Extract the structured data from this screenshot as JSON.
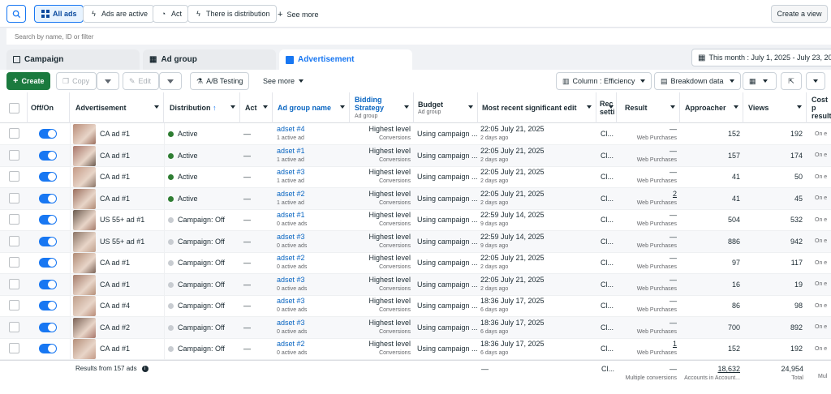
{
  "filters": {
    "all_ads": "All ads",
    "ads_active": "Ads are active",
    "act": "Act",
    "there_is_distribution": "There is distribution",
    "see_more": "See more",
    "create_view": "Create a view"
  },
  "search": {
    "placeholder": "Search by name, ID or filter"
  },
  "tabs": {
    "campaign": "Campaign",
    "ad_group": "Ad group",
    "advertisement": "Advertisement"
  },
  "date_range": "This month : July 1, 2025 - July 23, 2025",
  "toolbar": {
    "create": "Create",
    "copy": "Copy",
    "edit": "Edit",
    "ab_testing": "A/B Testing",
    "see_more": "See more",
    "column": "Column : Efficiency",
    "breakdown": "Breakdown data"
  },
  "columns": {
    "off_on": "Off/On",
    "advertisement": "Advertisement",
    "distribution": "Distribution",
    "act": "Act",
    "ad_group_name": "Ad group name",
    "bidding_strategy": "Bidding Strategy",
    "bidding_sub": "Ad group",
    "budget": "Budget",
    "budget_sub": "Ad group",
    "recent_edit": "Most recent significant edit",
    "rec_1": "Rec",
    "rec_2": "setti",
    "result": "Result",
    "approacher": "Approacher",
    "views": "Views",
    "cost_1": "Cost p",
    "cost_2": "result"
  },
  "rows": [
    {
      "ad": "CA ad #1",
      "dist": "Active",
      "act": "—",
      "adset": "adset #4",
      "adset_sub": "1 active ad",
      "bid": "Highest level",
      "bid_sub": "Conversions",
      "budget": "Using campaign ...",
      "edit": "22:05 July 21, 2025",
      "edit_sub": "2 days ago",
      "rec": "Cl...",
      "result": "—",
      "result_sub": "Web Purchases",
      "approacher": "152",
      "views": "192",
      "cost": "",
      "cost_sub": "On e"
    },
    {
      "ad": "CA ad #1",
      "dist": "Active",
      "act": "—",
      "adset": "adset #1",
      "adset_sub": "1 active ad",
      "bid": "Highest level",
      "bid_sub": "Conversions",
      "budget": "Using campaign ...",
      "edit": "22:05 July 21, 2025",
      "edit_sub": "2 days ago",
      "rec": "Cl...",
      "result": "—",
      "result_sub": "Web Purchases",
      "approacher": "157",
      "views": "174",
      "cost": "",
      "cost_sub": "On e"
    },
    {
      "ad": "CA ad #1",
      "dist": "Active",
      "act": "—",
      "adset": "adset #3",
      "adset_sub": "1 active ad",
      "bid": "Highest level",
      "bid_sub": "Conversions",
      "budget": "Using campaign ...",
      "edit": "22:05 July 21, 2025",
      "edit_sub": "2 days ago",
      "rec": "Cl...",
      "result": "—",
      "result_sub": "Web Purchases",
      "approacher": "41",
      "views": "50",
      "cost": "",
      "cost_sub": "On e"
    },
    {
      "ad": "CA ad #1",
      "dist": "Active",
      "act": "—",
      "adset": "adset #2",
      "adset_sub": "1 active ad",
      "bid": "Highest level",
      "bid_sub": "Conversions",
      "budget": "Using campaign ...",
      "edit": "22:05 July 21, 2025",
      "edit_sub": "2 days ago",
      "rec": "Cl...",
      "result": "2",
      "result_sub": "Web Purchases",
      "approacher": "41",
      "views": "45",
      "cost": "",
      "cost_sub": "On e"
    },
    {
      "ad": "US 55+ ad #1",
      "dist": "Campaign: Off",
      "act": "—",
      "adset": "adset #1",
      "adset_sub": "0 active ads",
      "bid": "Highest level",
      "bid_sub": "Conversions",
      "budget": "Using campaign ...",
      "edit": "22:59 July 14, 2025",
      "edit_sub": "9 days ago",
      "rec": "Cl...",
      "result": "—",
      "result_sub": "Web Purchases",
      "approacher": "504",
      "views": "532",
      "cost": "",
      "cost_sub": "On e"
    },
    {
      "ad": "US 55+ ad #1",
      "dist": "Campaign: Off",
      "act": "—",
      "adset": "adset #3",
      "adset_sub": "0 active ads",
      "bid": "Highest level",
      "bid_sub": "Conversions",
      "budget": "Using campaign ...",
      "edit": "22:59 July 14, 2025",
      "edit_sub": "9 days ago",
      "rec": "Cl...",
      "result": "—",
      "result_sub": "Web Purchases",
      "approacher": "886",
      "views": "942",
      "cost": "",
      "cost_sub": "On e"
    },
    {
      "ad": "CA ad #1",
      "dist": "Campaign: Off",
      "act": "—",
      "adset": "adset #2",
      "adset_sub": "0 active ads",
      "bid": "Highest level",
      "bid_sub": "Conversions",
      "budget": "Using campaign ...",
      "edit": "22:05 July 21, 2025",
      "edit_sub": "2 days ago",
      "rec": "Cl...",
      "result": "—",
      "result_sub": "Web Purchases",
      "approacher": "97",
      "views": "117",
      "cost": "",
      "cost_sub": "On e"
    },
    {
      "ad": "CA ad #1",
      "dist": "Campaign: Off",
      "act": "—",
      "adset": "adset #3",
      "adset_sub": "0 active ads",
      "bid": "Highest level",
      "bid_sub": "Conversions",
      "budget": "Using campaign ...",
      "edit": "22:05 July 21, 2025",
      "edit_sub": "2 days ago",
      "rec": "Cl...",
      "result": "—",
      "result_sub": "Web Purchases",
      "approacher": "16",
      "views": "19",
      "cost": "",
      "cost_sub": "On e"
    },
    {
      "ad": "CA ad #4",
      "dist": "Campaign: Off",
      "act": "—",
      "adset": "adset #3",
      "adset_sub": "0 active ads",
      "bid": "Highest level",
      "bid_sub": "Conversions",
      "budget": "Using campaign ...",
      "edit": "18:36 July 17, 2025",
      "edit_sub": "6 days ago",
      "rec": "Cl...",
      "result": "—",
      "result_sub": "Web Purchases",
      "approacher": "86",
      "views": "98",
      "cost": "",
      "cost_sub": "On e"
    },
    {
      "ad": "CA ad #2",
      "dist": "Campaign: Off",
      "act": "—",
      "adset": "adset #3",
      "adset_sub": "0 active ads",
      "bid": "Highest level",
      "bid_sub": "Conversions",
      "budget": "Using campaign ...",
      "edit": "18:36 July 17, 2025",
      "edit_sub": "6 days ago",
      "rec": "Cl...",
      "result": "—",
      "result_sub": "Web Purchases",
      "approacher": "700",
      "views": "892",
      "cost": "",
      "cost_sub": "On e"
    },
    {
      "ad": "CA ad #1",
      "dist": "Campaign: Off",
      "act": "—",
      "adset": "adset #2",
      "adset_sub": "0 active ads",
      "bid": "Highest level",
      "bid_sub": "Conversions",
      "budget": "Using campaign ...",
      "edit": "18:36 July 17, 2025",
      "edit_sub": "6 days ago",
      "rec": "Cl...",
      "result": "1",
      "result_sub": "Web Purchases",
      "approacher": "152",
      "views": "192",
      "cost": "",
      "cost_sub": "On e"
    }
  ],
  "footer": {
    "results": "Results from 157 ads",
    "edit": "—",
    "rec": "Cl...",
    "result": "—",
    "result_sub": "Multiple conversions",
    "approacher": "18,632",
    "approacher_sub": "Accounts in Account...",
    "views": "24,954",
    "views_sub": "Total",
    "cost_sub": "Mul"
  },
  "colors": {
    "accent": "#1877f2",
    "active_dot": "#2e7d32",
    "off_dot": "#c8ccd1",
    "create_btn": "#1b7a3e"
  }
}
